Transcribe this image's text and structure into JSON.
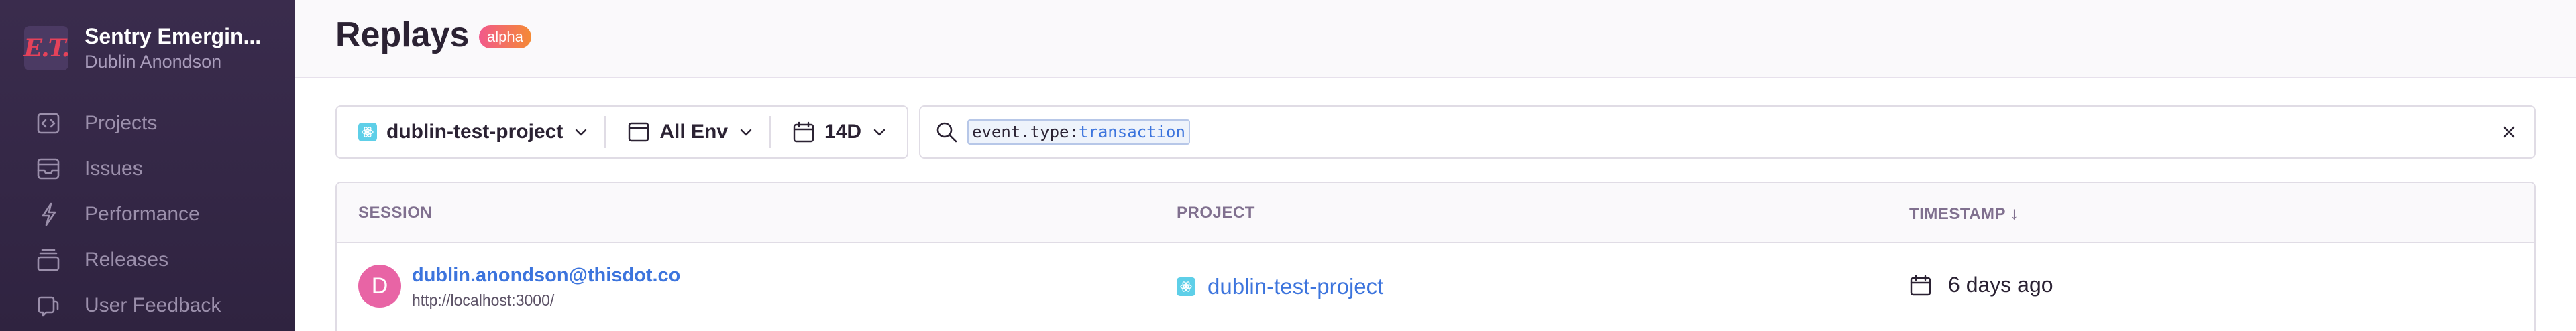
{
  "org": {
    "logo_text": "E.T.",
    "name": "Sentry Emergin...",
    "user": "Dublin Anondson"
  },
  "sidebar": {
    "items": [
      {
        "label": "Projects",
        "icon": "projects-icon"
      },
      {
        "label": "Issues",
        "icon": "issues-icon"
      },
      {
        "label": "Performance",
        "icon": "performance-icon"
      },
      {
        "label": "Releases",
        "icon": "releases-icon"
      },
      {
        "label": "User Feedback",
        "icon": "user-feedback-icon"
      }
    ]
  },
  "header": {
    "title": "Replays",
    "badge": "alpha"
  },
  "filters": {
    "project": "dublin-test-project",
    "environment": "All Env",
    "date_range": "14D"
  },
  "search": {
    "token_key": "event.type:",
    "token_value": "transaction"
  },
  "table": {
    "columns": {
      "session": "SESSION",
      "project": "PROJECT",
      "timestamp": "TIMESTAMP",
      "timestamp_sort": "↓"
    },
    "rows": [
      {
        "avatar_initial": "D",
        "email": "dublin.anondson@thisdot.co",
        "url": "http://localhost:3000/",
        "project": "dublin-test-project",
        "timestamp": "6 days ago"
      }
    ]
  },
  "colors": {
    "sidebar_bg": "#3a2c4d",
    "accent_link": "#3c74dd",
    "avatar": "#e864a5",
    "project_icon": "#5ecfe8"
  }
}
